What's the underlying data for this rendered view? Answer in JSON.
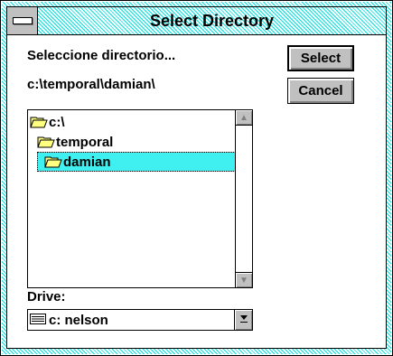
{
  "window": {
    "title": "Select Directory"
  },
  "prompt": "Seleccione directorio...",
  "current_path": "c:\\temporal\\damian\\",
  "buttons": {
    "select": "Select",
    "cancel": "Cancel"
  },
  "tree": [
    {
      "label": "c:\\",
      "icon": "open-folder-icon",
      "level": 0,
      "selected": false
    },
    {
      "label": "temporal",
      "icon": "open-folder-icon",
      "level": 1,
      "selected": false
    },
    {
      "label": "damian",
      "icon": "open-folder-icon",
      "level": 2,
      "selected": true
    }
  ],
  "drive": {
    "label": "Drive:",
    "value": "c: nelson",
    "icon": "drive-icon"
  },
  "colors": {
    "accent": "#40f0f0",
    "frame": "#00e0e0",
    "face": "#c0c0c0"
  }
}
